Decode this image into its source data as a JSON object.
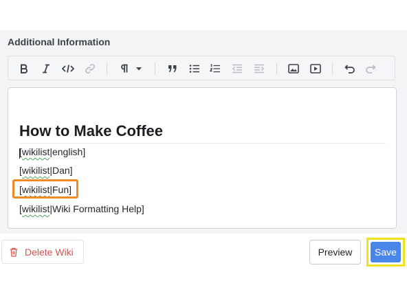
{
  "section": {
    "title": "Additional Information"
  },
  "toolbar": {
    "buttons": [
      "bold-icon",
      "italic-icon",
      "code-icon",
      "link-icon",
      "paragraph-icon",
      "chevron-down-icon",
      "quote-icon",
      "bullet-list-icon",
      "numbered-list-icon",
      "outdent-icon",
      "indent-icon",
      "image-icon",
      "video-icon",
      "undo-icon",
      "redo-icon"
    ]
  },
  "editor": {
    "heading": "How to Make Coffee",
    "lines": [
      {
        "open": "[",
        "word": "wikilist",
        "rest": "|english]"
      },
      {
        "open": "[",
        "word": "wikilist",
        "rest": "|Dan]"
      },
      {
        "open": "[",
        "word": "wikilist",
        "rest": "|Fun]"
      },
      {
        "open": "[",
        "word": "wikilist",
        "rest": "|Wiki Formatting Help]"
      }
    ]
  },
  "actions": {
    "delete_label": "Delete Wiki",
    "preview_label": "Preview",
    "save_label": "Save"
  },
  "colors": {
    "highlight_orange": "#f08a24",
    "highlight_yellow": "#f2e01a",
    "save_blue": "#4a86e8",
    "delete_red": "#d2554f"
  }
}
